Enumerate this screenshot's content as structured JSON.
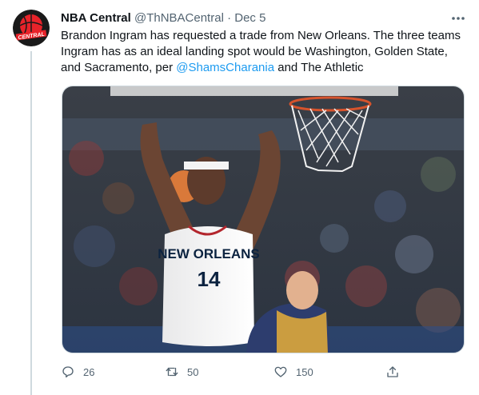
{
  "tweet": {
    "author_name": "NBA Central",
    "handle": "@ThNBACentral",
    "separator": "·",
    "date": "Dec 5",
    "text_part1": "Brandon Ingram has requested a trade from New Orleans.  The three teams Ingram has as an ideal landing spot would be Washington, Golden State, and Sacramento, per ",
    "mention": "@ShamsCharania",
    "text_part2": " and The Athletic",
    "avatar_text": "CENTRAL",
    "jersey": {
      "team": "NEW ORLEANS",
      "number": "14"
    }
  },
  "actions": {
    "reply_count": "26",
    "retweet_count": "50",
    "like_count": "150"
  },
  "icons": [
    "more-icon",
    "reply-icon",
    "retweet-icon",
    "like-icon",
    "share-icon"
  ]
}
